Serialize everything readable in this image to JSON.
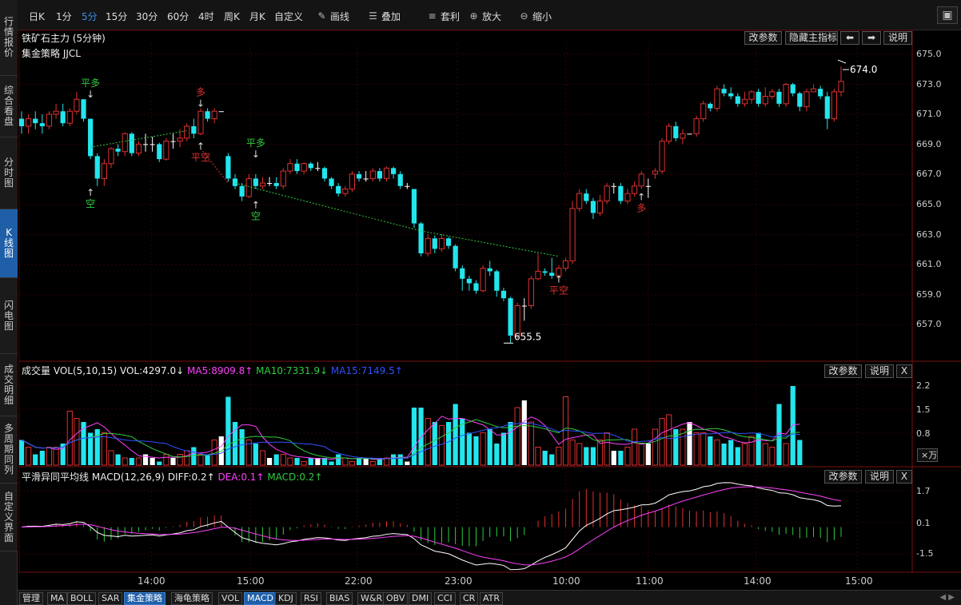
{
  "sidebar": {
    "tabs": [
      {
        "label": "行情报价",
        "active": false
      },
      {
        "label": "综合看盘",
        "active": false
      },
      {
        "label": "分时图",
        "active": false
      },
      {
        "label": "K线图",
        "active": true
      },
      {
        "label": "闪电图",
        "active": false
      },
      {
        "label": "成交明细",
        "active": false
      },
      {
        "label": "多周期同列",
        "active": false
      },
      {
        "label": "自定义界面",
        "active": false
      }
    ]
  },
  "toolbar": {
    "periods": [
      "日K",
      "1分",
      "5分",
      "15分",
      "30分",
      "60分",
      "4时",
      "周K",
      "月K",
      "自定义"
    ],
    "active_period": "5分",
    "draw_label": "画线",
    "overlay_label": "叠加",
    "arbitrage_label": "套利",
    "zoom_in_label": "放大",
    "zoom_out_label": "缩小"
  },
  "main_panel": {
    "title": "铁矿石主力 (5分钟)",
    "strategy": "集金策略 JJCL",
    "buttons": {
      "edit_params": "改参数",
      "hide_indicator": "隐藏主指标",
      "help": "说明"
    },
    "high_label": "674.0",
    "low_label": "655.5",
    "price_ticks": [
      "675.0",
      "673.0",
      "671.0",
      "669.0",
      "667.0",
      "665.0",
      "663.0",
      "661.0",
      "659.0",
      "657.0"
    ],
    "signals": [
      {
        "text": "平多",
        "color": "#2ecc40"
      },
      {
        "text": "空",
        "color": "#2ecc40"
      },
      {
        "text": "多",
        "color": "#e03030"
      },
      {
        "text": "平空",
        "color": "#e03030"
      },
      {
        "text": "平多",
        "color": "#2ecc40"
      },
      {
        "text": "空",
        "color": "#2ecc40"
      },
      {
        "text": "平空",
        "color": "#e03030"
      },
      {
        "text": "多",
        "color": "#e03030"
      }
    ]
  },
  "volume_panel": {
    "label": "成交量",
    "params": "VOL(5,10,15)",
    "vol": "VOL:4297.0↓",
    "ma5": "MA5:8909.8↑",
    "ma10": "MA10:7331.9↓",
    "ma15": "MA15:7149.5↑",
    "buttons": {
      "edit_params": "改参数",
      "help": "说明",
      "close": "X"
    },
    "ticks": [
      "2.2",
      "1.5",
      "0.8"
    ],
    "unit": "×万"
  },
  "macd_panel": {
    "label": "平滑异同平均线",
    "params": "MACD(12,26,9)",
    "diff": "DIFF:0.2↑",
    "dea": "DEA:0.1↑",
    "macd": "MACD:0.2↑",
    "buttons": {
      "edit_params": "改参数",
      "help": "说明",
      "close": "X"
    },
    "ticks": [
      "1.7",
      "0.1",
      "-1.5"
    ]
  },
  "x_axis": {
    "labels": [
      "14:00",
      "15:00",
      "22:00",
      "23:00",
      "10:00",
      "11:00",
      "14:00",
      "15:00"
    ]
  },
  "bottom_tabs": [
    "管理",
    "MA",
    "BOLL",
    "SAR",
    "集金策略",
    "海龟策略",
    "VOL",
    "MACD",
    "KDJ",
    "RSI",
    "BIAS",
    "W&R",
    "OBV",
    "DMI",
    "CCI",
    "CR",
    "ATR"
  ],
  "bottom_active": [
    "集金策略",
    "MACD"
  ],
  "colors": {
    "up": "#e03030",
    "down": "#22e6ee",
    "ma5": "#ff40ff",
    "ma10": "#2ecc40",
    "ma15": "#3050ff",
    "accent": "#1f5fa8"
  },
  "chart_data": {
    "type": "candlestick",
    "title": "铁矿石主力 (5分钟)",
    "y_range": [
      654.5,
      675.5
    ],
    "candles": [
      [
        670.5,
        670.0,
        671.0,
        669.5
      ],
      [
        670.0,
        670.5,
        670.8,
        669.5
      ],
      [
        670.5,
        670.2,
        671.0,
        669.8
      ],
      [
        670.2,
        670.0,
        670.8,
        669.5
      ],
      [
        670.0,
        670.8,
        671.0,
        669.8
      ],
      [
        670.8,
        671.0,
        671.5,
        670.5
      ],
      [
        671.0,
        670.2,
        671.5,
        670.0
      ],
      [
        670.2,
        671.0,
        671.2,
        670.0
      ],
      [
        671.0,
        671.8,
        672.3,
        670.8
      ],
      [
        671.8,
        670.5,
        671.8,
        670.3
      ],
      [
        670.5,
        668.0,
        670.5,
        667.8
      ],
      [
        668.0,
        666.5,
        668.2,
        666.0
      ],
      [
        666.5,
        667.5,
        667.8,
        666.0
      ],
      [
        667.5,
        668.5,
        668.6,
        667.2
      ],
      [
        668.5,
        668.3,
        668.8,
        668.0
      ],
      [
        668.3,
        669.5,
        669.6,
        668.0
      ],
      [
        669.5,
        668.2,
        669.6,
        668.0
      ],
      [
        668.2,
        668.8,
        669.0,
        668.0
      ],
      [
        668.8,
        668.8,
        669.5,
        668.3
      ],
      [
        668.8,
        668.8,
        669.3,
        668.3
      ],
      [
        668.8,
        667.8,
        668.9,
        667.6
      ],
      [
        667.8,
        669.0,
        669.2,
        667.7
      ],
      [
        669.0,
        669.0,
        669.5,
        668.5
      ],
      [
        669.0,
        669.2,
        669.8,
        668.6
      ],
      [
        669.2,
        670.0,
        670.2,
        669.0
      ],
      [
        670.0,
        669.5,
        670.5,
        669.2
      ],
      [
        669.5,
        671.0,
        671.2,
        669.4
      ],
      [
        671.0,
        670.5,
        671.2,
        670.3
      ],
      [
        670.5,
        671.0,
        671.2,
        670.2
      ],
      [
        671.0,
        671.0,
        671.0,
        671.0
      ],
      [
        668.0,
        666.5,
        668.2,
        666.3
      ],
      [
        666.5,
        666.0,
        666.8,
        665.8
      ],
      [
        666.0,
        665.3,
        666.2,
        665.0
      ],
      [
        665.3,
        666.5,
        666.8,
        665.2
      ],
      [
        666.5,
        666.0,
        666.8,
        665.8
      ],
      [
        666.0,
        666.2,
        666.6,
        665.8
      ],
      [
        666.2,
        666.2,
        666.6,
        666.0
      ],
      [
        666.2,
        666.0,
        666.6,
        665.8
      ],
      [
        666.0,
        667.0,
        667.2,
        665.8
      ],
      [
        667.0,
        667.5,
        667.8,
        666.8
      ],
      [
        667.5,
        667.0,
        667.8,
        666.8
      ],
      [
        667.0,
        667.5,
        667.6,
        666.8
      ],
      [
        667.5,
        667.2,
        667.6,
        667.0
      ],
      [
        667.2,
        667.2,
        667.6,
        667.0
      ],
      [
        667.2,
        666.5,
        667.3,
        666.3
      ],
      [
        666.5,
        666.0,
        666.6,
        665.8
      ],
      [
        666.0,
        665.5,
        666.2,
        665.3
      ],
      [
        665.5,
        665.8,
        666.0,
        665.3
      ],
      [
        665.8,
        666.8,
        667.0,
        665.6
      ],
      [
        666.8,
        666.5,
        667.0,
        666.3
      ],
      [
        666.5,
        666.5,
        667.0,
        666.3
      ],
      [
        666.5,
        667.0,
        667.2,
        666.3
      ],
      [
        667.0,
        666.5,
        667.2,
        666.3
      ],
      [
        666.5,
        667.2,
        667.3,
        666.3
      ],
      [
        667.2,
        666.8,
        667.3,
        666.5
      ],
      [
        666.8,
        666.0,
        667.0,
        665.8
      ],
      [
        666.0,
        666.0,
        666.2,
        665.8
      ],
      [
        665.8,
        663.5,
        665.8,
        663.2
      ],
      [
        663.5,
        661.5,
        663.6,
        661.3
      ],
      [
        661.5,
        662.5,
        662.8,
        661.3
      ],
      [
        662.5,
        661.8,
        662.7,
        661.5
      ],
      [
        661.8,
        662.5,
        662.8,
        661.6
      ],
      [
        662.5,
        662.0,
        662.6,
        661.8
      ],
      [
        662.0,
        660.5,
        662.1,
        660.3
      ],
      [
        660.5,
        659.8,
        660.7,
        659.0
      ],
      [
        659.8,
        659.5,
        660.0,
        659.0
      ],
      [
        659.5,
        659.0,
        659.7,
        658.8
      ],
      [
        659.0,
        660.5,
        660.7,
        658.9
      ],
      [
        660.5,
        660.3,
        661.0,
        660.0
      ],
      [
        660.3,
        659.0,
        660.4,
        658.6
      ],
      [
        659.0,
        658.5,
        659.2,
        658.3
      ],
      [
        658.5,
        656.0,
        658.6,
        655.5
      ],
      [
        656.0,
        658.0,
        658.2,
        655.8
      ],
      [
        658.0,
        658.0,
        658.5,
        657.0
      ],
      [
        658.0,
        659.8,
        660.0,
        657.8
      ],
      [
        659.8,
        660.3,
        661.5,
        659.7
      ],
      [
        660.3,
        660.2,
        660.5,
        660.0
      ],
      [
        660.2,
        660.0,
        661.2,
        659.8
      ],
      [
        660.0,
        660.5,
        660.7,
        659.8
      ],
      [
        660.5,
        661.0,
        661.2,
        660.3
      ],
      [
        661.0,
        664.5,
        665.0,
        660.8
      ],
      [
        664.5,
        665.5,
        665.8,
        664.3
      ],
      [
        665.5,
        665.0,
        665.8,
        664.8
      ],
      [
        665.0,
        664.2,
        665.2,
        663.8
      ],
      [
        664.2,
        665.0,
        665.4,
        664.0
      ],
      [
        665.0,
        666.0,
        666.2,
        664.8
      ],
      [
        666.0,
        666.0,
        666.2,
        665.5
      ],
      [
        666.0,
        665.0,
        666.2,
        664.8
      ],
      [
        665.0,
        665.5,
        665.8,
        664.8
      ],
      [
        665.5,
        666.0,
        666.3,
        665.3
      ],
      [
        666.0,
        666.8,
        667.0,
        665.8
      ],
      [
        666.0,
        666.0,
        666.5,
        665.2
      ],
      [
        666.8,
        667.0,
        667.2,
        666.5
      ],
      [
        667.0,
        669.0,
        669.2,
        666.8
      ],
      [
        669.0,
        670.0,
        670.2,
        668.8
      ],
      [
        670.0,
        669.2,
        670.3,
        669.0
      ],
      [
        669.2,
        669.5,
        669.8,
        668.8
      ],
      [
        669.5,
        669.5,
        669.5,
        669.5
      ],
      [
        669.5,
        670.5,
        670.7,
        669.3
      ],
      [
        670.5,
        671.5,
        671.7,
        670.3
      ],
      [
        671.5,
        671.2,
        671.6,
        671.0
      ],
      [
        671.2,
        672.5,
        672.7,
        671.0
      ],
      [
        672.5,
        672.2,
        672.8,
        672.0
      ],
      [
        672.2,
        672.0,
        672.6,
        671.8
      ],
      [
        672.0,
        671.5,
        672.2,
        671.3
      ],
      [
        671.5,
        671.8,
        672.3,
        671.3
      ],
      [
        671.8,
        672.3,
        672.4,
        671.5
      ],
      [
        672.3,
        671.5,
        672.5,
        671.3
      ],
      [
        671.5,
        672.0,
        672.6,
        671.3
      ],
      [
        672.0,
        672.3,
        672.5,
        671.8
      ],
      [
        672.3,
        671.5,
        672.5,
        671.3
      ],
      [
        671.5,
        672.8,
        672.9,
        671.3
      ],
      [
        672.8,
        672.2,
        672.9,
        672.0
      ],
      [
        672.2,
        671.3,
        672.3,
        671.0
      ],
      [
        671.3,
        672.3,
        672.5,
        671.0
      ],
      [
        672.3,
        672.5,
        672.8,
        672.3
      ],
      [
        672.5,
        672.0,
        672.7,
        671.8
      ],
      [
        672.0,
        670.5,
        672.3,
        669.8
      ],
      [
        670.5,
        672.3,
        672.5,
        670.3
      ],
      [
        672.3,
        673.0,
        674.0,
        672.0
      ]
    ],
    "volume": [
      0.7,
      0.5,
      0.3,
      0.4,
      0.5,
      0.5,
      0.6,
      1.5,
      1.3,
      1.2,
      0.9,
      1.0,
      0.9,
      0.4,
      0.3,
      0.2,
      0.2,
      0.2,
      0.3,
      0.2,
      0.1,
      0.3,
      0.2,
      0.3,
      0.4,
      0.5,
      0.3,
      0.3,
      0.7,
      0.8,
      1.9,
      1.2,
      1.0,
      0.7,
      0.6,
      0.4,
      0.2,
      0.3,
      0.3,
      0.2,
      0.2,
      0.1,
      0.2,
      0.2,
      0.2,
      0.1,
      0.3,
      0.2,
      0.1,
      0.2,
      0.2,
      0.1,
      0.2,
      0.2,
      0.3,
      0.3,
      0.1,
      1.6,
      1.6,
      1.3,
      1.2,
      1.1,
      1.2,
      1.7,
      1.3,
      0.9,
      0.8,
      0.9,
      1.0,
      0.6,
      0.9,
      1.2,
      1.6,
      1.8,
      1.2,
      0.5,
      0.4,
      0.3,
      0.5,
      1.9,
      0.7,
      0.6,
      0.5,
      0.5,
      0.7,
      0.9,
      0.4,
      0.4,
      0.5,
      1.0,
      0.6,
      0.6,
      1.0,
      1.3,
      1.4,
      1.0,
      1.0,
      1.2,
      0.9,
      0.9,
      0.8,
      0.7,
      0.6,
      0.7,
      0.5,
      0.6,
      0.8,
      0.9,
      0.6,
      0.5,
      1.7,
      0.6,
      2.2,
      0.7
    ],
    "ylim_volume": [
      0,
      2.4
    ],
    "ylim_macd": [
      -2.3,
      2.3
    ]
  }
}
